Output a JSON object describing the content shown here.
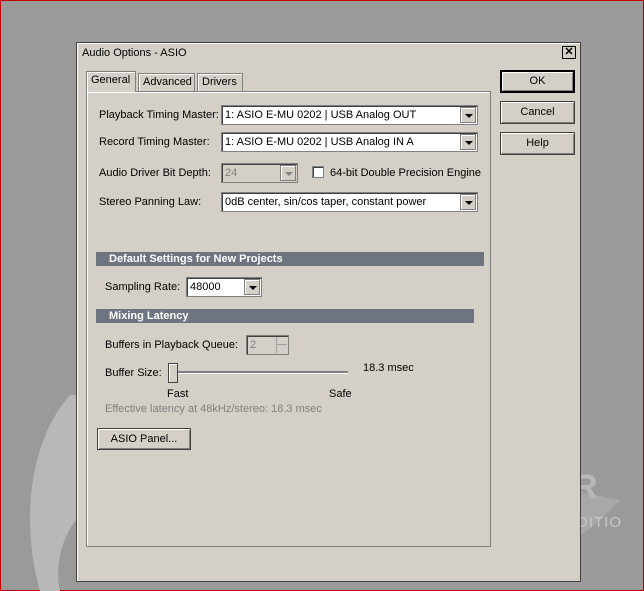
{
  "dialog": {
    "title": "Audio Options - ASIO",
    "close_glyph": "✕"
  },
  "tabs": [
    {
      "label": "General",
      "active": true
    },
    {
      "label": "Advanced",
      "active": false
    },
    {
      "label": "Drivers",
      "active": false
    }
  ],
  "general": {
    "playback_timing_master": {
      "label": "Playback Timing Master:",
      "value": "1: ASIO E-MU 0202 | USB Analog OUT"
    },
    "record_timing_master": {
      "label": "Record Timing Master:",
      "value": "1: ASIO E-MU 0202 | USB Analog IN A"
    },
    "bit_depth": {
      "label": "Audio Driver Bit Depth:",
      "value": "24"
    },
    "double_precision": {
      "label": "64-bit Double Precision Engine",
      "checked": false
    },
    "panning_law": {
      "label": "Stereo Panning Law:",
      "value": "0dB center, sin/cos taper, constant power"
    }
  },
  "defaults": {
    "heading": "Default Settings for New Projects",
    "sampling_rate": {
      "label": "Sampling Rate:",
      "value": "48000"
    }
  },
  "latency": {
    "heading": "Mixing Latency",
    "buffers": {
      "label": "Buffers in Playback Queue:",
      "value": "2"
    },
    "buffer_size": {
      "label": "Buffer Size:",
      "readout": "18.3 msec",
      "position_fraction": 0.0
    },
    "fast_label": "Fast",
    "safe_label": "Safe",
    "effective": "Effective latency at 48kHz/stereo:  18.3 msec",
    "asio_panel_button": "ASIO Panel..."
  },
  "buttons": {
    "ok": "OK",
    "cancel": "Cancel",
    "help": "Help"
  },
  "background": {
    "logo_letter": "R",
    "edition_text": "EDITIO"
  },
  "colors": {
    "dialog_face": "#d4d0c8",
    "section_header": "#6e7480",
    "desktop": "#9a9a9a"
  }
}
